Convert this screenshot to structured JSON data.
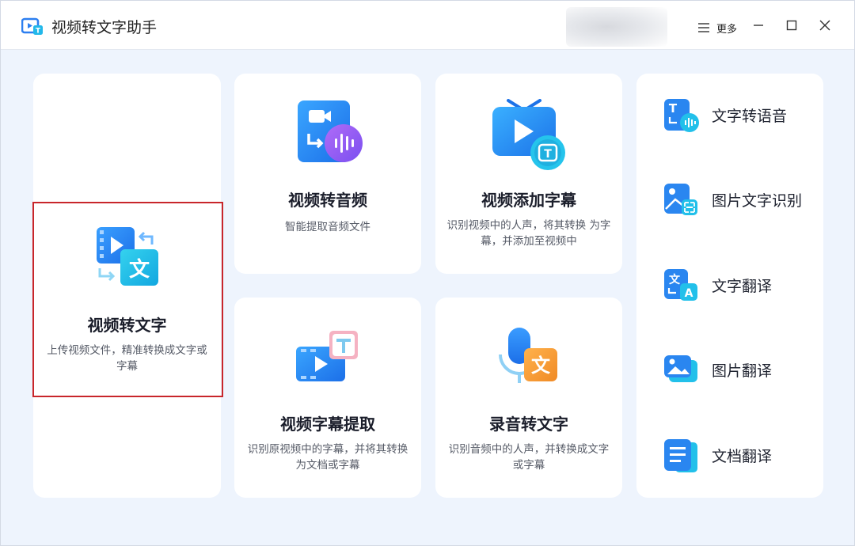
{
  "app": {
    "title": "视频转文字助手"
  },
  "titlebar": {
    "more_label": "更多"
  },
  "cards": {
    "video_to_text": {
      "title": "视频转文字",
      "desc": "上传视频文件，精准转换成文字或字幕"
    },
    "video_to_audio": {
      "title": "视频转音频",
      "desc": "智能提取音频文件"
    },
    "video_add_subtitle": {
      "title": "视频添加字幕",
      "desc": "识别视频中的人声，将其转换 为字幕，并添加至视频中"
    },
    "video_subtitle_extract": {
      "title": "视频字幕提取",
      "desc": "识别原视频中的字幕，并将其转换为文档或字幕"
    },
    "audio_to_text": {
      "title": "录音转文字",
      "desc": "识别音频中的人声，并转换成文字或字幕"
    }
  },
  "side": {
    "items": [
      {
        "label": "文字转语音",
        "icon": "text-to-speech-icon"
      },
      {
        "label": "图片文字识别",
        "icon": "image-ocr-icon"
      },
      {
        "label": "文字翻译",
        "icon": "text-translate-icon"
      },
      {
        "label": "图片翻译",
        "icon": "image-translate-icon"
      },
      {
        "label": "文档翻译",
        "icon": "document-translate-icon"
      }
    ]
  },
  "colors": {
    "accent_blue": "#1f8ef0",
    "accent_cyan": "#22c3e6",
    "accent_purple": "#8b5cf6",
    "accent_orange": "#f59a3c",
    "accent_pink": "#f2a0b4",
    "selection_red": "#c8262b"
  }
}
